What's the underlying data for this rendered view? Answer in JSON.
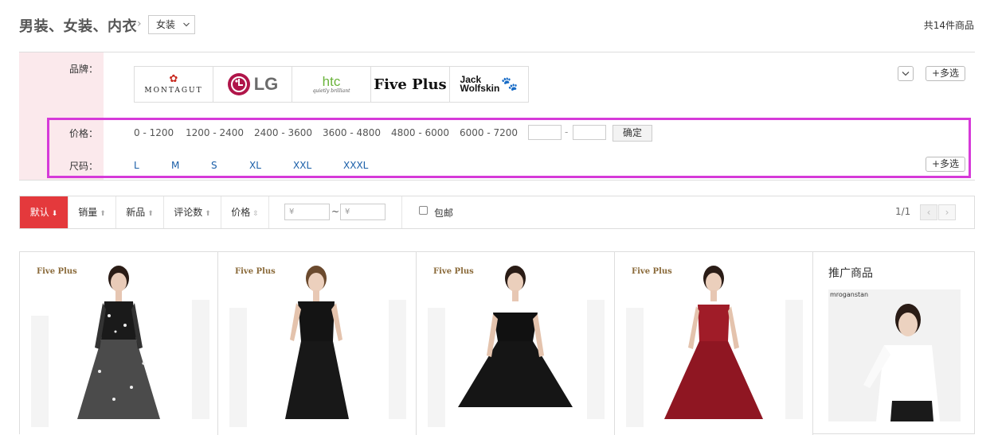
{
  "breadcrumb": {
    "title": "男装、女装、内衣",
    "sep": "›",
    "dropdown_value": "女装"
  },
  "total": "共14件商品",
  "filters": {
    "brand_label": "品牌：",
    "brands": [
      {
        "name": "MONTAGUT",
        "logo_text": "MONTAGUT"
      },
      {
        "name": "LG",
        "logo_text": "LG"
      },
      {
        "name": "htc",
        "logo_text": "htc",
        "tagline": "quietly brilliant"
      },
      {
        "name": "Five Plus",
        "logo_text": "Five Plus"
      },
      {
        "name": "Jack Wolfskin",
        "logo_text_1": "Jack",
        "logo_text_2": "Wolfskin"
      }
    ],
    "multi_label": "+多选",
    "price_label": "价格：",
    "prices": [
      "0 - 1200",
      "1200 - 2400",
      "2400 - 3600",
      "3600 - 4800",
      "4800 - 6000",
      "6000 - 7200"
    ],
    "price_dash": "-",
    "confirm_label": "确定",
    "size_label": "尺码：",
    "sizes": [
      "L",
      "M",
      "S",
      "XL",
      "XXL",
      "XXXL"
    ]
  },
  "sort": {
    "items": [
      {
        "label": "默认",
        "active": true
      },
      {
        "label": "销量"
      },
      {
        "label": "新品"
      },
      {
        "label": "评论数"
      },
      {
        "label": "价格"
      }
    ],
    "price_from_placeholder": "¥",
    "price_to_placeholder": "¥",
    "range_sep": "~",
    "free_shipping_label": "包邮",
    "page": "1/1",
    "prev": "‹",
    "next": "›"
  },
  "products": [
    {
      "brand": "Five Plus",
      "dress_color": "#1a1a1a",
      "style": "sheer-star"
    },
    {
      "brand": "Five Plus",
      "dress_color": "#141414",
      "style": "cap-sleeve"
    },
    {
      "brand": "Five Plus",
      "dress_color": "#111111",
      "style": "off-shoulder"
    },
    {
      "brand": "Five Plus",
      "dress_color": "#a01c28",
      "style": "sleeveless"
    }
  ],
  "promo": {
    "title": "推广商品",
    "brand": "mroganstan"
  },
  "colors": {
    "accent": "#e4393c",
    "highlight": "#d63ad9",
    "label_bg": "#fbe9ec"
  }
}
